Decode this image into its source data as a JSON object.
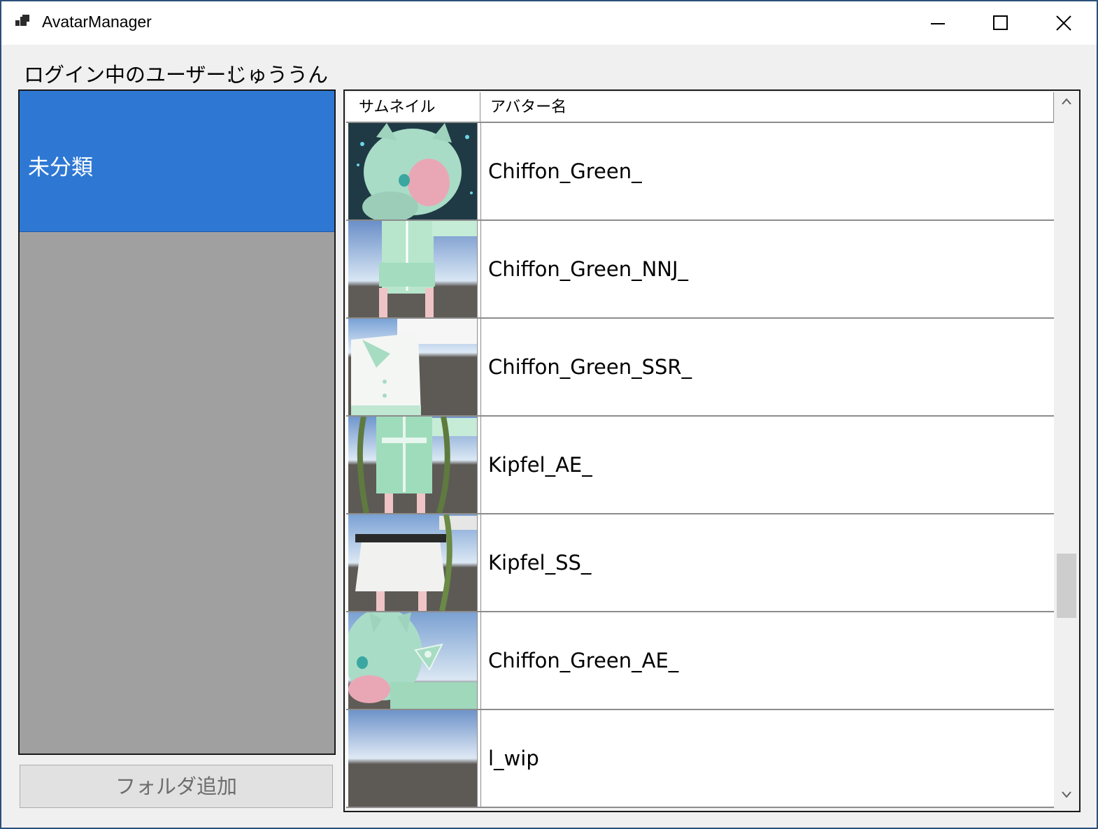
{
  "window": {
    "title": "AvatarManager",
    "icons": {
      "app": "app-icon",
      "minimize": "minimize-icon",
      "maximize": "maximize-icon",
      "close": "close-icon"
    }
  },
  "login": {
    "label": "ログイン中のユーザー:",
    "user": "じゅううん"
  },
  "folders": {
    "items": [
      {
        "label": "未分類",
        "selected": true
      }
    ],
    "add_button": "フォルダ追加"
  },
  "grid": {
    "columns": [
      "サムネイル",
      "アバター名"
    ],
    "rows": [
      {
        "name": "Chiffon_Green_"
      },
      {
        "name": "Chiffon_Green_NNJ_"
      },
      {
        "name": "Chiffon_Green_SSR_"
      },
      {
        "name": "Kipfel_AE_"
      },
      {
        "name": "Kipfel_SS_"
      },
      {
        "name": "Chiffon_Green_AE_"
      },
      {
        "name": "l_wip"
      }
    ]
  },
  "colors": {
    "selected_folder": "#2e78d4",
    "folder_panel_bg": "#a0a0a0",
    "window_border": "#2d4f7a"
  }
}
